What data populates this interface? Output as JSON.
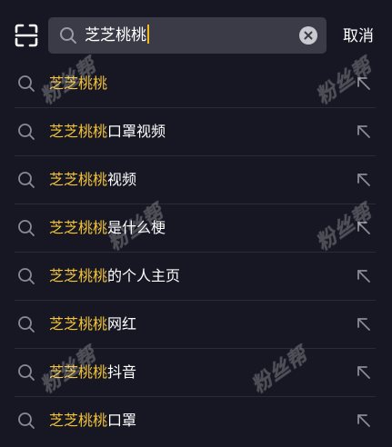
{
  "search": {
    "query": "芝芝桃桃",
    "cancel_label": "取消"
  },
  "suggestions": [
    {
      "highlight": "芝芝桃桃",
      "rest": ""
    },
    {
      "highlight": "芝芝桃桃",
      "rest": "口罩视频"
    },
    {
      "highlight": "芝芝桃桃",
      "rest": "视频"
    },
    {
      "highlight": "芝芝桃桃",
      "rest": "是什么梗"
    },
    {
      "highlight": "芝芝桃桃",
      "rest": "的个人主页"
    },
    {
      "highlight": "芝芝桃桃",
      "rest": "网红"
    },
    {
      "highlight": "芝芝桃桃",
      "rest": "抖音"
    },
    {
      "highlight": "芝芝桃桃",
      "rest": "口罩"
    }
  ],
  "watermark": "粉丝帮",
  "icons": {
    "scan": "scan-icon",
    "search": "search-icon",
    "clear": "clear-icon",
    "fill_arrow": "arrow-up-left-icon"
  },
  "colors": {
    "background": "#161722",
    "search_box": "#3a3b46",
    "highlight": "#f3c33a",
    "caret": "#f3b91b",
    "text": "#ffffff",
    "icon": "#8a8b94"
  }
}
